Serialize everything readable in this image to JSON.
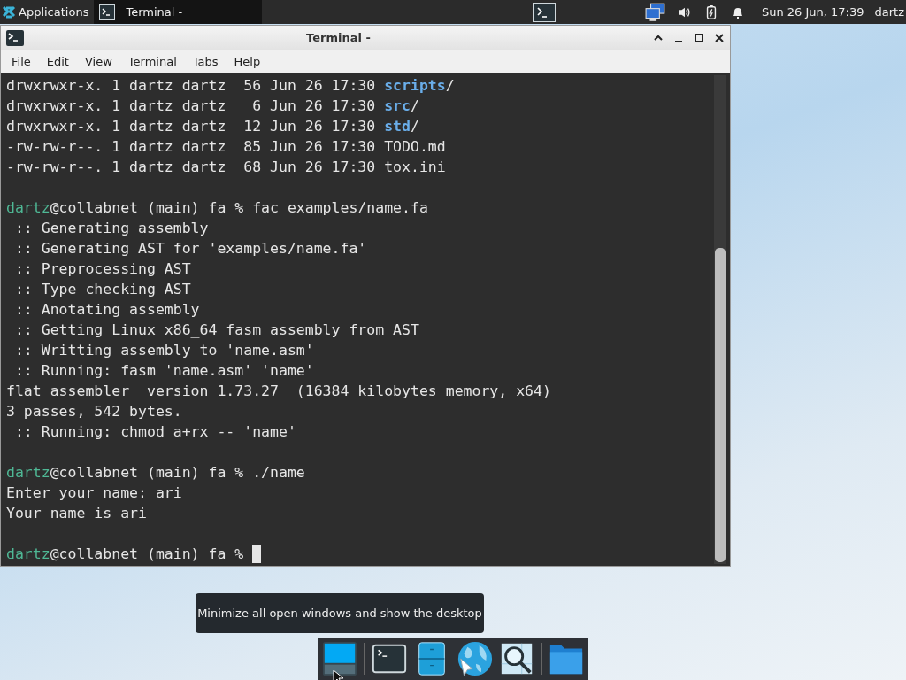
{
  "top_panel": {
    "apps_label": "Applications",
    "task": {
      "title": "Terminal -",
      "selected": true
    },
    "clock": "Sun 26 Jun, 17:39",
    "user": "dartz"
  },
  "window": {
    "title": "Terminal -",
    "menu": [
      "File",
      "Edit",
      "View",
      "Terminal",
      "Tabs",
      "Help"
    ]
  },
  "terminal": {
    "lines": [
      {
        "kind": "text",
        "segments": [
          {
            "kind": "plain",
            "text": "drwxrwxr-x. 1 dartz dartz  56 Jun 26 17:30 "
          },
          {
            "kind": "dir",
            "text": "scripts"
          },
          {
            "kind": "plain",
            "text": "/"
          }
        ]
      },
      {
        "kind": "text",
        "segments": [
          {
            "kind": "plain",
            "text": "drwxrwxr-x. 1 dartz dartz   6 Jun 26 17:30 "
          },
          {
            "kind": "dir",
            "text": "src"
          },
          {
            "kind": "plain",
            "text": "/"
          }
        ]
      },
      {
        "kind": "text",
        "segments": [
          {
            "kind": "plain",
            "text": "drwxrwxr-x. 1 dartz dartz  12 Jun 26 17:30 "
          },
          {
            "kind": "dir",
            "text": "std"
          },
          {
            "kind": "plain",
            "text": "/"
          }
        ]
      },
      {
        "kind": "text",
        "segments": [
          {
            "kind": "plain",
            "text": "-rw-rw-r--. 1 dartz dartz  85 Jun 26 17:30 TODO.md"
          }
        ]
      },
      {
        "kind": "text",
        "segments": [
          {
            "kind": "plain",
            "text": "-rw-rw-r--. 1 dartz dartz  68 Jun 26 17:30 tox.ini"
          }
        ]
      },
      {
        "kind": "blank"
      },
      {
        "kind": "text",
        "segments": [
          {
            "kind": "user",
            "text": "dartz"
          },
          {
            "kind": "plain",
            "text": "@collabnet (main) fa % fac examples/name.fa"
          }
        ]
      },
      {
        "kind": "text",
        "segments": [
          {
            "kind": "plain",
            "text": " :: Generating assembly"
          }
        ]
      },
      {
        "kind": "text",
        "segments": [
          {
            "kind": "plain",
            "text": " :: Generating AST for 'examples/name.fa'"
          }
        ]
      },
      {
        "kind": "text",
        "segments": [
          {
            "kind": "plain",
            "text": " :: Preprocessing AST"
          }
        ]
      },
      {
        "kind": "text",
        "segments": [
          {
            "kind": "plain",
            "text": " :: Type checking AST"
          }
        ]
      },
      {
        "kind": "text",
        "segments": [
          {
            "kind": "plain",
            "text": " :: Anotating assembly"
          }
        ]
      },
      {
        "kind": "text",
        "segments": [
          {
            "kind": "plain",
            "text": " :: Getting Linux x86_64 fasm assembly from AST"
          }
        ]
      },
      {
        "kind": "text",
        "segments": [
          {
            "kind": "plain",
            "text": " :: Writting assembly to 'name.asm'"
          }
        ]
      },
      {
        "kind": "text",
        "segments": [
          {
            "kind": "plain",
            "text": " :: Running: fasm 'name.asm' 'name'"
          }
        ]
      },
      {
        "kind": "text",
        "segments": [
          {
            "kind": "plain",
            "text": "flat assembler  version 1.73.27  (16384 kilobytes memory, x64)"
          }
        ]
      },
      {
        "kind": "text",
        "segments": [
          {
            "kind": "plain",
            "text": "3 passes, 542 bytes."
          }
        ]
      },
      {
        "kind": "text",
        "segments": [
          {
            "kind": "plain",
            "text": " :: Running: chmod a+rx -- 'name'"
          }
        ]
      },
      {
        "kind": "blank"
      },
      {
        "kind": "text",
        "segments": [
          {
            "kind": "user",
            "text": "dartz"
          },
          {
            "kind": "plain",
            "text": "@collabnet (main) fa % ./name"
          }
        ]
      },
      {
        "kind": "text",
        "segments": [
          {
            "kind": "plain",
            "text": "Enter your name: ari"
          }
        ]
      },
      {
        "kind": "text",
        "segments": [
          {
            "kind": "plain",
            "text": "Your name is ari"
          }
        ]
      },
      {
        "kind": "blank"
      },
      {
        "kind": "text",
        "cursor": true,
        "segments": [
          {
            "kind": "user",
            "text": "dartz"
          },
          {
            "kind": "plain",
            "text": "@collabnet (main) fa % "
          }
        ]
      }
    ]
  },
  "tooltip": "Minimize all open windows and show the desktop"
}
